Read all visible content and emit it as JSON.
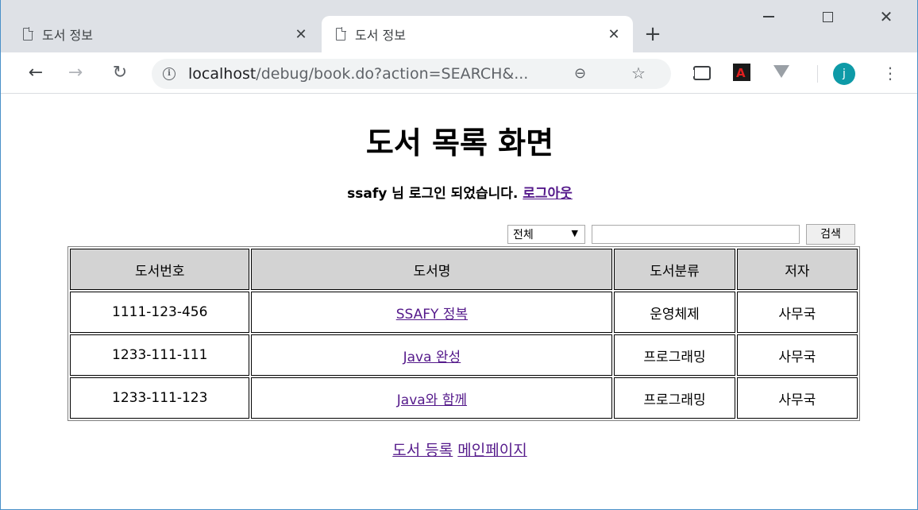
{
  "tabs": [
    {
      "title": "도서 정보",
      "close": "✕"
    },
    {
      "title": "도서 정보",
      "close": "✕"
    }
  ],
  "new_tab": "+",
  "window_controls": {
    "close": "✕"
  },
  "toolbar": {
    "url_host": "localhost",
    "url_path": "/debug/book.do?action=SEARCH&...",
    "avatar_letter": "j"
  },
  "page": {
    "title": "도서 목록 화면",
    "login_text": "ssafy 님 로그인 되었습니다.",
    "logout_link": "로그아웃",
    "search": {
      "select_value": "전체",
      "input_value": "",
      "button": "검색"
    },
    "table": {
      "headers": [
        "도서번호",
        "도서명",
        "도서분류",
        "저자"
      ],
      "rows": [
        {
          "isbn": "1111-123-456",
          "title": "SSAFY 정복",
          "category": "운영체제",
          "author": "사무국"
        },
        {
          "isbn": "1233-111-111",
          "title": "Java 완성",
          "category": "프로그래밍",
          "author": "사무국"
        },
        {
          "isbn": "1233-111-123",
          "title": "Java와 함께",
          "category": "프로그래밍",
          "author": "사무국"
        }
      ]
    },
    "links": {
      "register": "도서 등록",
      "main": "메인페이지"
    }
  }
}
